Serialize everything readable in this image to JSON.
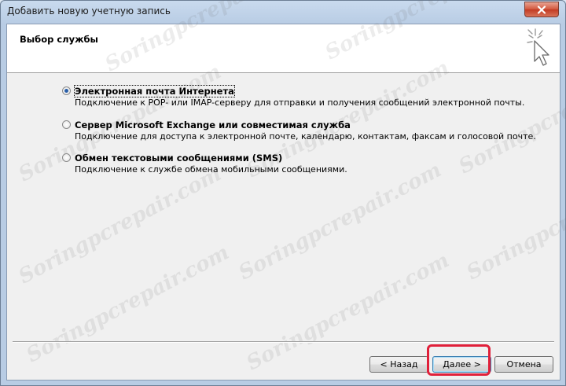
{
  "window": {
    "title": "Добавить новую учетную запись"
  },
  "header": {
    "title": "Выбор службы"
  },
  "options": [
    {
      "label": "Электронная почта Интернета",
      "description": "Подключение к POP- или IMAP-серверу для отправки и получения сообщений электронной почты.",
      "checked": true
    },
    {
      "label": "Сервер Microsoft Exchange или совместимая служба",
      "description": "Подключение для доступа к электронной почте, календарю, контактам, факсам и голосовой почте.",
      "checked": false
    },
    {
      "label": "Обмен текстовыми сообщениями (SMS)",
      "description": "Подключение к службе обмена мобильными сообщениями.",
      "checked": false
    }
  ],
  "buttons": {
    "back": "< Назад",
    "next": "Далее >",
    "cancel": "Отмена"
  },
  "watermark": "Soringpcrepair.com",
  "colors": {
    "highlight": "#e0203a",
    "radio_dot": "#2a5fa8"
  }
}
